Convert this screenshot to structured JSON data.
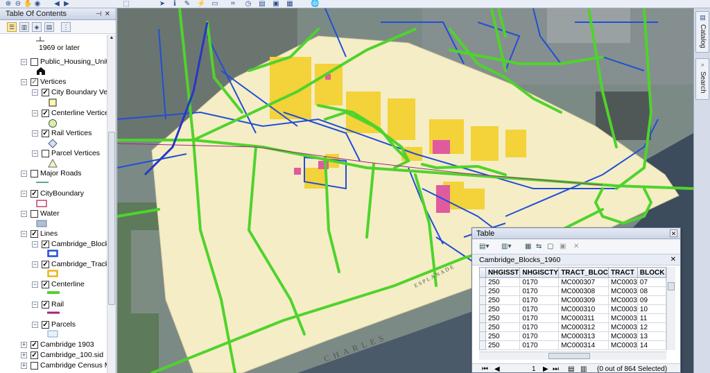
{
  "toc": {
    "title": "Table Of Contents",
    "rows": [
      {
        "label": "1969 or later",
        "checked": null
      },
      {
        "label": "Public_Housing_Units",
        "checked": false
      },
      {
        "label": "Vertices",
        "checked": true
      },
      {
        "label": "City Boundary Verti",
        "checked": true
      },
      {
        "label": "Centerline Vertices",
        "checked": true
      },
      {
        "label": "Rail Vertices",
        "checked": true
      },
      {
        "label": "Parcel Vertices",
        "checked": false
      },
      {
        "label": "Major Roads",
        "checked": false
      },
      {
        "label": "CityBoundary",
        "checked": true
      },
      {
        "label": "Water",
        "checked": false
      },
      {
        "label": "Lines",
        "checked": true
      },
      {
        "label": "Cambridge_Blocks",
        "checked": true
      },
      {
        "label": "Cambridge_Tracks",
        "checked": true
      },
      {
        "label": "Centerline",
        "checked": true
      },
      {
        "label": "Rail",
        "checked": true
      },
      {
        "label": "Parcels",
        "checked": true
      },
      {
        "label": "Cambridge 1903",
        "checked": true
      },
      {
        "label": "Cambridge_100.sid",
        "checked": true
      },
      {
        "label": "Cambridge Census Ma",
        "checked": false
      }
    ]
  },
  "dock": {
    "catalog_label": "Catalog",
    "search_label": "Search"
  },
  "map_labels": {
    "charles": "CHARLES",
    "esplanade": "ESPLANADE"
  },
  "table": {
    "window_title": "Table",
    "layer_tab": "Cambridge_Blocks_1960",
    "columns": [
      "NHGISST",
      "NHGISCTY",
      "TRACT_BLOC",
      "TRACT",
      "BLOCK"
    ],
    "rows": [
      [
        "250",
        "0170",
        "MC000307",
        "MC0003",
        "07"
      ],
      [
        "250",
        "0170",
        "MC000308",
        "MC0003",
        "08"
      ],
      [
        "250",
        "0170",
        "MC000309",
        "MC0003",
        "09"
      ],
      [
        "250",
        "0170",
        "MC000310",
        "MC0003",
        "10"
      ],
      [
        "250",
        "0170",
        "MC000311",
        "MC0003",
        "11"
      ],
      [
        "250",
        "0170",
        "MC000312",
        "MC0003",
        "12"
      ],
      [
        "250",
        "0170",
        "MC000313",
        "MC0003",
        "13"
      ],
      [
        "250",
        "0170",
        "MC000314",
        "MC0003",
        "14"
      ]
    ],
    "record_number": "1",
    "selection_status": "(0 out of 864 Selected)"
  },
  "colors": {
    "centerline": "#4fd32c",
    "blocks": "#1f4fd6",
    "tracks": "#f0b21a",
    "rail": "#a0237d",
    "parcels_fill": "#cfe3f7",
    "water": "#3d4c5c",
    "old_map": "#f5edc6"
  }
}
